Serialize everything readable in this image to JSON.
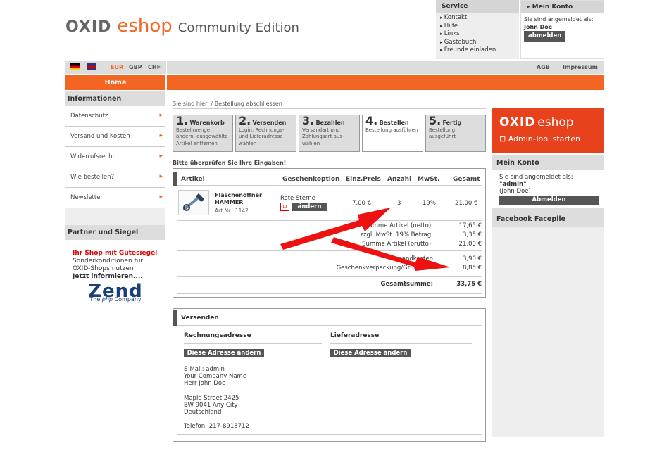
{
  "header": {
    "logo_oxid": "OXID",
    "logo_eshop": "eshop",
    "edition": "Community Edition"
  },
  "service": {
    "title": "Service",
    "links": [
      "Kontakt",
      "Hilfe",
      "Links",
      "Gästebuch",
      "Freunde einladen"
    ]
  },
  "account_top": {
    "title": "Mein Konto",
    "logged_in": "Sie sind angemeldet als:",
    "user": "John Doe",
    "logout": "abmelden"
  },
  "currencies": [
    "EUR",
    "GBP",
    "CHF"
  ],
  "top_links": [
    "AGB",
    "Impressum"
  ],
  "nav": {
    "home": "Home"
  },
  "sidebar": {
    "info_title": "Informationen",
    "info_items": [
      "Datenschutz",
      "Versand und Kosten",
      "Widerrufsrecht",
      "Wie bestellen?",
      "Newsletter"
    ],
    "partner_title": "Partner und Siegel",
    "seal_title": "Ihr Shop mit Gütesiegel",
    "seal_text1": "Sonderkonditionen für",
    "seal_text2": "OXID-Shops nutzen!",
    "seal_link": "Jetzt informieren....",
    "zend_text": "Zend",
    "zend_sub_pre": "The ",
    "zend_sub_php": "php",
    "zend_sub_post": " Company"
  },
  "breadcrumb": "Sie sind hier: / Bestellung abschliessen",
  "steps": [
    {
      "num": "1.",
      "title": "Warenkorb",
      "desc": "Bestellmenge ändern, ausgewählte Artikel entfernen"
    },
    {
      "num": "2.",
      "title": "Versenden",
      "desc": "Login, Rechnungs- und Lieferadresse wählen"
    },
    {
      "num": "3.",
      "title": "Bezahlen",
      "desc": "Versandart und Zahlungsart aus-wählen"
    },
    {
      "num": "4.",
      "title": "Bestellen",
      "desc": "Bestellung ausführen"
    },
    {
      "num": "5.",
      "title": "Fertig",
      "desc": "Bestellung ausgeführt"
    }
  ],
  "check_note": "Bitte überprüfen Sie Ihre Eingaben!",
  "table": {
    "headers": [
      "Artikel",
      "Geschenkoption",
      "Einz.Preis",
      "Anzahl",
      "MwSt.",
      "Gesamt"
    ],
    "item": {
      "name": "Flaschenöffner HAMMER",
      "artnr": "Art.Nr.: 1142",
      "gift": "Rote Sterne",
      "change": "ändern",
      "price": "7,00 €",
      "qty": "3",
      "vat": "19%",
      "total": "21,00 €"
    }
  },
  "summary": [
    {
      "label": "Summe Artikel (netto):",
      "value": "17,65 €"
    },
    {
      "label": "zzgl. MwSt. 19% Betrag:",
      "value": "3,35 €"
    },
    {
      "label": "Summe Artikel (brutto):",
      "value": "21,00 €"
    }
  ],
  "shipping_row": {
    "label": "Versandkosten",
    "value": "3,90 €"
  },
  "wrap_row": {
    "label": "Geschenkverpackung/Grußkarte",
    "value": "8,85 €"
  },
  "grand_total": {
    "label": "Gesamtsumme:",
    "value": "33,75 €"
  },
  "versenden": {
    "title": "Versenden",
    "billing_title": "Rechnungsadresse",
    "delivery_title": "Lieferadresse",
    "change_btn": "Diese Adresse ändern",
    "lines": [
      "E-Mail: admin",
      "Your Company Name",
      "Herr John Doe",
      "",
      "Maple Street 2425",
      "BW 9041 Any City",
      "Deutschland",
      "",
      "Telefon: 217-8918712"
    ]
  },
  "right": {
    "banner_title_oxid": "OXID",
    "banner_title_eshop": "eshop",
    "banner_sub": "Admin-Tool starten",
    "konto_title": "Mein Konto",
    "logged_in": "Sie sind angemeldet als:",
    "user": "\"admin\"",
    "user_name": "(John Doe)",
    "logout": "Abmelden",
    "facebook": "Facebook Facepile"
  },
  "colors": {
    "accent": "#f26522",
    "annotation_arrow": "#ee1111"
  }
}
